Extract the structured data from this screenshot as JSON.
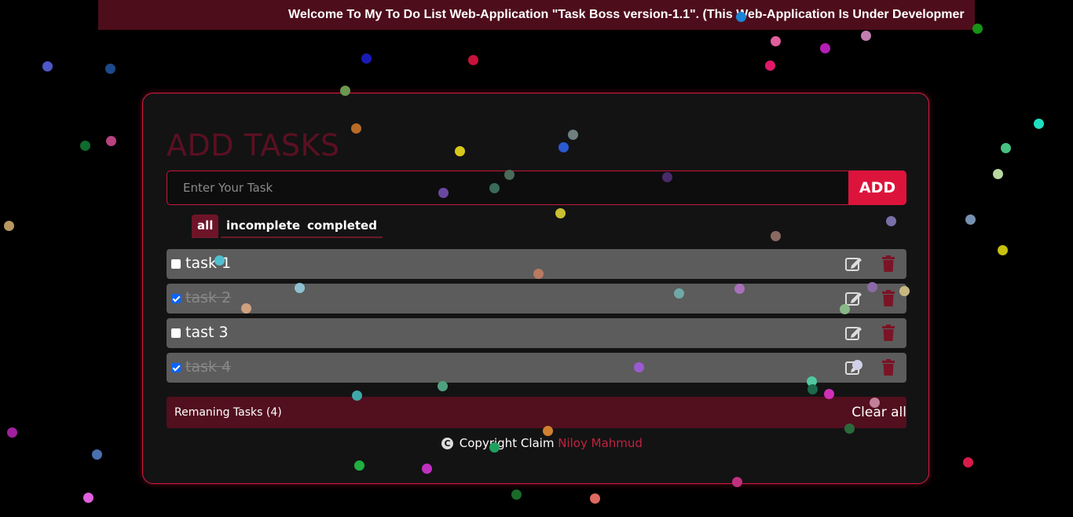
{
  "banner": {
    "text": "Welcome To My To Do List Web-Application \"Task Boss version-1.1\". (This Web-Application Is Under Developmer"
  },
  "app": {
    "title": "ADD TASKS",
    "input_placeholder": "Enter Your Task",
    "input_value": "",
    "add_label": "ADD",
    "accent_color": "#dc143c"
  },
  "filters": [
    {
      "label": "all",
      "active": true
    },
    {
      "label": "incomplete",
      "active": false
    },
    {
      "label": "completed",
      "active": false
    }
  ],
  "tasks": [
    {
      "label": "task 1",
      "completed": false
    },
    {
      "label": "task 2",
      "completed": true
    },
    {
      "label": "tast 3",
      "completed": false
    },
    {
      "label": "task 4",
      "completed": true
    }
  ],
  "footer": {
    "remaining": "Remaning Tasks (4)",
    "clear_label": "Clear all"
  },
  "copyright": {
    "text": "Copyright Claim",
    "author": "Niloy Mahmud"
  },
  "icons": {
    "copyright": "copyright-icon",
    "edit": "edit-icon",
    "delete": "trash-icon"
  }
}
